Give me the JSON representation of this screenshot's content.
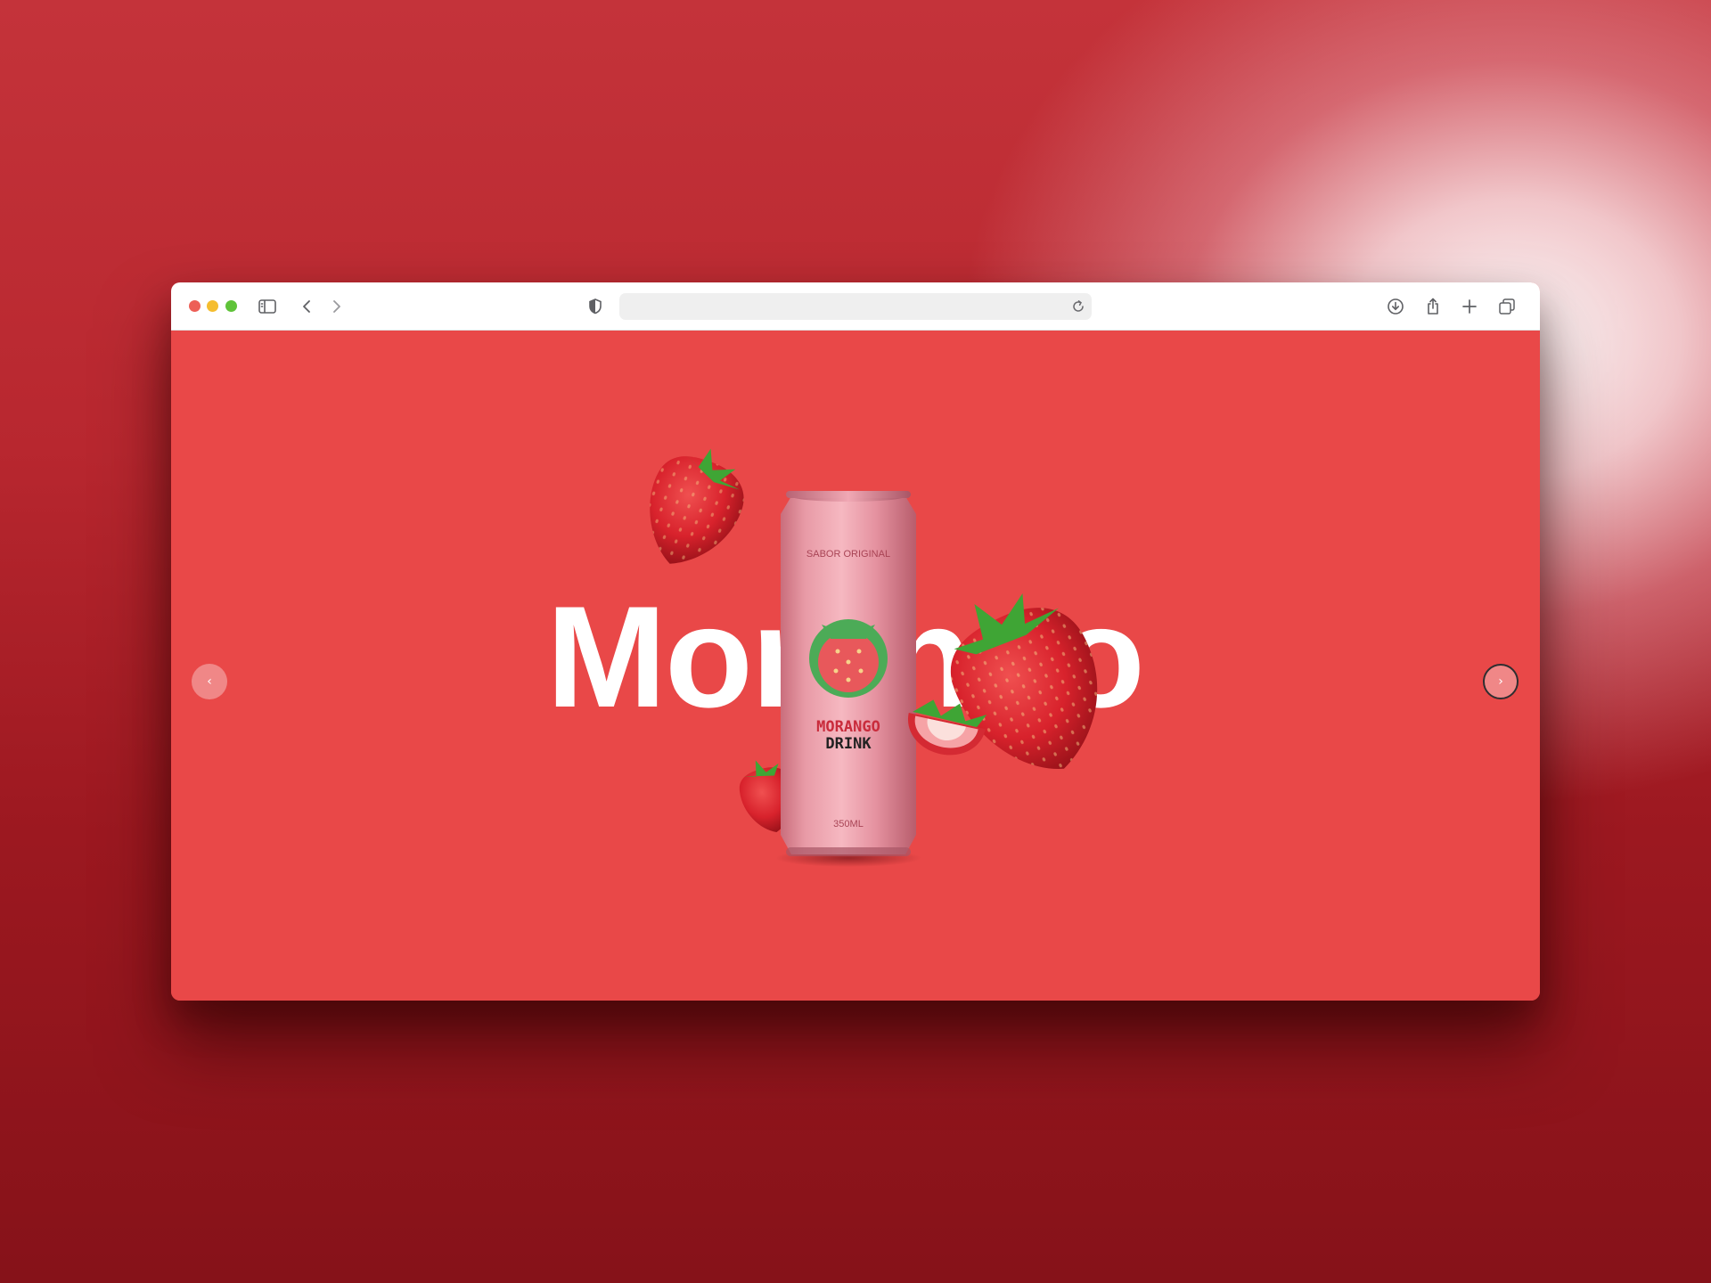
{
  "browser": {
    "url_text": "",
    "icons": [
      "sidebar-icon",
      "back-icon",
      "forward-icon",
      "shield-icon",
      "reload-icon",
      "download-icon",
      "share-icon",
      "new-tab-icon",
      "tabs-overview-icon"
    ]
  },
  "page": {
    "hero_word": "Morango",
    "prev_label": "‹",
    "next_label": "›",
    "background_color": "#e94848"
  },
  "can": {
    "top_text": "SABOR ORIGINAL",
    "brand_line1": "MORANGO",
    "brand_line2": "DRINK",
    "volume": "350ML",
    "color": "#e89aa6"
  }
}
